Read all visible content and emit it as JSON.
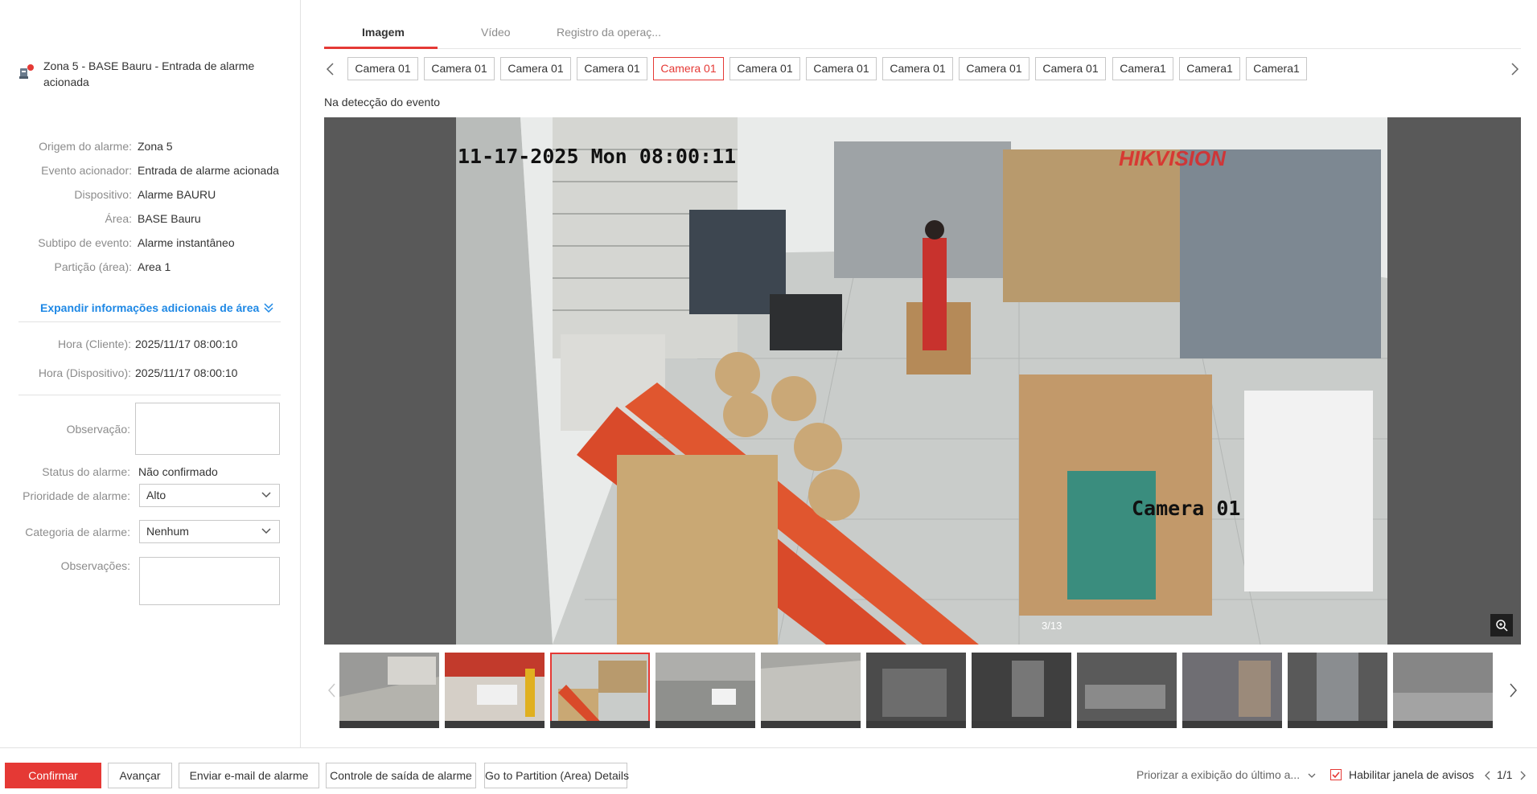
{
  "alarm": {
    "title": "Zona 5 - BASE Bauru - Entrada de alarme acionada",
    "details": [
      {
        "label": "Origem do alarme:",
        "value": "Zona 5"
      },
      {
        "label": "Evento acionador:",
        "value": "Entrada de alarme acionada"
      },
      {
        "label": "Dispositivo:",
        "value": "Alarme BAURU"
      },
      {
        "label": "Área:",
        "value": "BASE Bauru"
      },
      {
        "label": "Subtipo de evento:",
        "value": "Alarme instantâneo"
      },
      {
        "label": "Partição (área):",
        "value": "Area 1"
      }
    ],
    "expand_label": "Expandir informações adicionais de área",
    "times": [
      {
        "label": "Hora (Cliente):",
        "value": "2025/11/17 08:00:10"
      },
      {
        "label": "Hora (Dispositivo):",
        "value": "2025/11/17 08:00:10"
      }
    ],
    "observation_label": "Observação:",
    "observation_value": "",
    "status_label": "Status do alarme:",
    "status_value": "Não confirmado",
    "priority_label": "Prioridade de alarme:",
    "priority_value": "Alto",
    "category_label": "Categoria de alarme:",
    "category_value": "Nenhum",
    "remarks_label": "Observações:",
    "remarks_value": ""
  },
  "tabs": [
    {
      "label": "Imagem",
      "active": true
    },
    {
      "label": "Vídeo",
      "active": false
    },
    {
      "label": "Registro da operaç...",
      "active": false
    }
  ],
  "cameras": [
    {
      "label": "Camera 01",
      "active": false
    },
    {
      "label": "Camera 01",
      "active": false
    },
    {
      "label": "Camera 01",
      "active": false
    },
    {
      "label": "Camera 01",
      "active": false
    },
    {
      "label": "Camera 01",
      "active": true
    },
    {
      "label": "Camera 01",
      "active": false
    },
    {
      "label": "Camera 01",
      "active": false
    },
    {
      "label": "Camera 01",
      "active": false
    },
    {
      "label": "Camera 01",
      "active": false
    },
    {
      "label": "Camera 01",
      "active": false
    },
    {
      "label": "Camera1",
      "active": false
    },
    {
      "label": "Camera1",
      "active": false
    },
    {
      "label": "Camera1",
      "active": false
    }
  ],
  "event_label": "Na detecção do evento",
  "viewer": {
    "osd_timestamp": "11-17-2025 Mon 08:00:11",
    "osd_brand": "HIKVISION",
    "osd_camera": "Camera 01",
    "counter": "3/13"
  },
  "footer": {
    "confirm": "Confirmar",
    "next": "Avançar",
    "email": "Enviar e-mail de alarme",
    "output": "Controle de saída de alarme",
    "partition": "Go to Partition (Area) Details",
    "prioritize": "Priorizar a exibição do último a...",
    "enable_popup": "Habilitar janela de avisos",
    "page": "1/1"
  },
  "colors": {
    "accent": "#e53935",
    "link": "#1e88e5"
  }
}
